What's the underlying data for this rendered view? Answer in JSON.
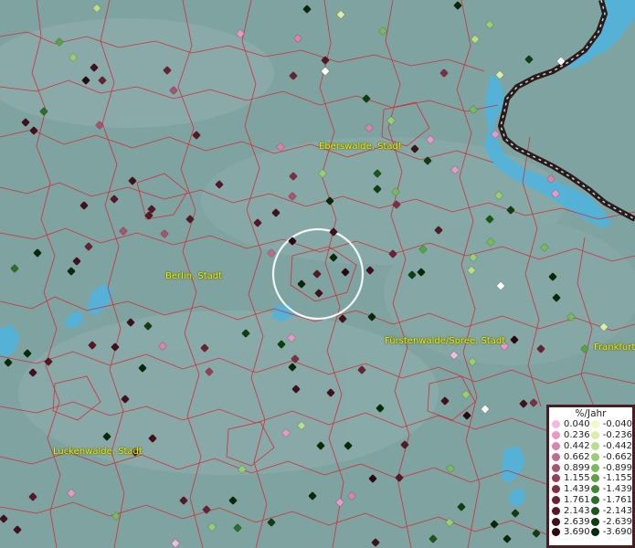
{
  "map": {
    "labels": [
      {
        "id": "eberswalde",
        "text": "Eberswalde, Stadt"
      },
      {
        "id": "berlin",
        "text": "Berlin, Stadt"
      },
      {
        "id": "fuerstenwalde",
        "text": "Fürstenwalde/Spree, Stadt"
      },
      {
        "id": "frankfurt",
        "text": "Frankfurt"
      },
      {
        "id": "luckenwalde",
        "text": "Luckenwalde, Stadt"
      }
    ],
    "colors": {
      "background": "#7fa3a1",
      "boundary": "#d8242c",
      "water": "#4fb4e0",
      "border": "#2a1a1a",
      "focus_ring": "#ffffff"
    }
  },
  "legend": {
    "title": "%/Jahr",
    "positive": [
      {
        "value": "0.040",
        "color": "#f5b8e0"
      },
      {
        "value": "0.236",
        "color": "#e79ac8"
      },
      {
        "value": "0.442",
        "color": "#d884ad"
      },
      {
        "value": "0.662",
        "color": "#c06a8f"
      },
      {
        "value": "0.899",
        "color": "#a85470"
      },
      {
        "value": "1.155",
        "color": "#933f58"
      },
      {
        "value": "1.439",
        "color": "#7e2f44"
      },
      {
        "value": "1.761",
        "color": "#6a2233"
      },
      {
        "value": "2.143",
        "color": "#561826"
      },
      {
        "value": "2.639",
        "color": "#41101b"
      },
      {
        "value": "3.690",
        "color": "#2a0810"
      }
    ],
    "negative": [
      {
        "value": "-0.040",
        "color": "#f3f8c2"
      },
      {
        "value": "-0.236",
        "color": "#d8efa8"
      },
      {
        "value": "-0.442",
        "color": "#b7df8a"
      },
      {
        "value": "-0.662",
        "color": "#98cf72"
      },
      {
        "value": "-0.899",
        "color": "#78bb5c"
      },
      {
        "value": "-1.155",
        "color": "#57a445"
      },
      {
        "value": "-1.439",
        "color": "#3d8a35"
      },
      {
        "value": "-1.761",
        "color": "#2a7028"
      },
      {
        "value": "-2.143",
        "color": "#1b571b"
      },
      {
        "value": "-2.639",
        "color": "#0f3e10"
      },
      {
        "value": "-3.690",
        "color": "#062a08"
      }
    ]
  }
}
